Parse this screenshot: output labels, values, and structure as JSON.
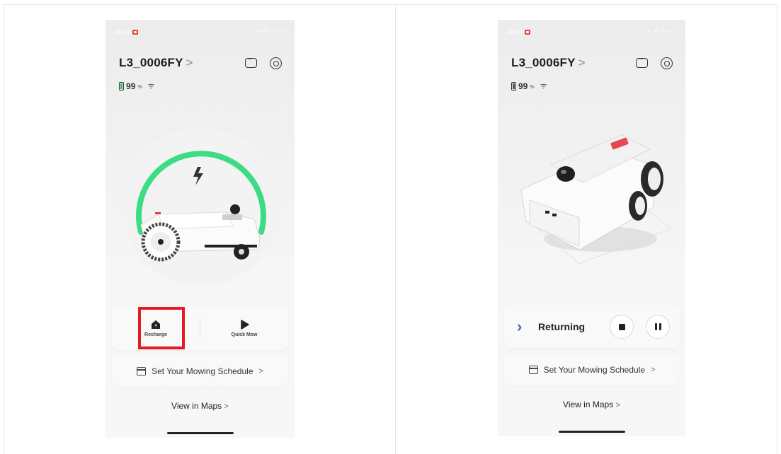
{
  "left_phone": {
    "status_time": "16:49",
    "status_right": "≋ ⁵ᴳ.ıl ≈ ▭",
    "device_name": "L3_0006FY",
    "name_chevron": ">",
    "battery_percent": "99",
    "battery_unit": "%",
    "actions": {
      "recharge_label": "Recharge",
      "quick_mow_label": "Quick Mow"
    },
    "schedule_label": "Set Your Mowing Schedule",
    "schedule_chevron": ">",
    "maps_label": "View in Maps",
    "maps_chevron": ">",
    "charge_ring_color": "#3ddc84",
    "highlight_color": "#e31b23"
  },
  "right_phone": {
    "status_time": "16:49",
    "status_right": "≋ ⁵ᴳ.ıl ≈ ▭",
    "device_name": "L3_0006FY",
    "name_chevron": ">",
    "battery_percent": "99",
    "battery_unit": "%",
    "status_label": "Returning",
    "schedule_label": "Set Your Mowing Schedule",
    "schedule_chevron": ">",
    "maps_label": "View in Maps",
    "maps_chevron": ">"
  },
  "icons": {
    "recharge": "home-charge-icon",
    "quick_mow": "play-icon",
    "stop": "stop-icon",
    "pause": "pause-icon",
    "chat": "chat-icon",
    "settings": "settings-icon",
    "calendar": "calendar-icon",
    "wifi": "wifi-icon",
    "battery": "battery-icon"
  }
}
